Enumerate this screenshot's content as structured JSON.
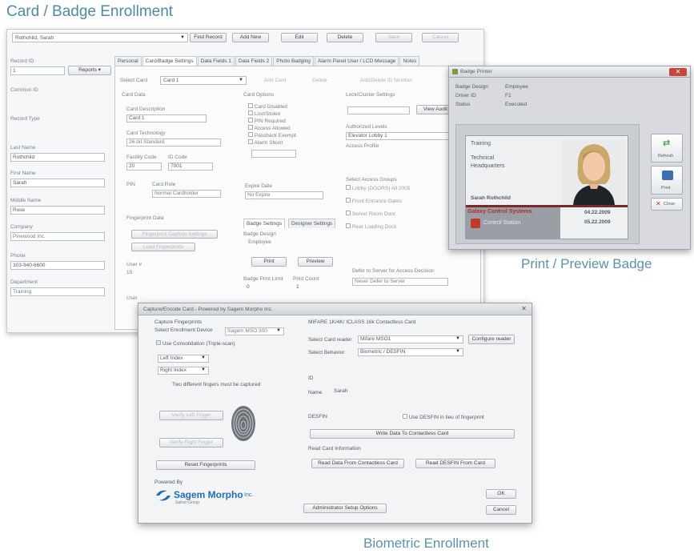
{
  "captions": {
    "title": "Card / Badge Enrollment",
    "print_preview": "Print / Preview Badge",
    "biometric": "Biometric Enrollment"
  },
  "main": {
    "name_select": "Rothchild, Sarah",
    "toolbar": [
      "Find Record",
      "Add New",
      "Edit",
      "Delete",
      "Save",
      "Cancel"
    ],
    "left_fields": [
      {
        "label": "Record ID",
        "value": "1"
      },
      {
        "label": "Common ID",
        "value": ""
      },
      {
        "label": "Record Type",
        "value": ""
      },
      {
        "label": "Last Name",
        "value": "Rothchild"
      },
      {
        "label": "First Name",
        "value": "Sarah"
      },
      {
        "label": "Middle Name",
        "value": "Rose"
      },
      {
        "label": "Company",
        "value": "Pinewood Inc."
      },
      {
        "label": "Phone",
        "value": "303-940-6600"
      },
      {
        "label": "Department",
        "value": "Training"
      }
    ],
    "reports_button": "Reports",
    "tabs": [
      "Personal",
      "Card/Badge Settings",
      "Data Fields 1",
      "Data Fields 2",
      "Photo Badging",
      "Alarm Panel User / LCD Message",
      "Notes"
    ],
    "select_card_label": "Select Card",
    "select_card_value": "Card 1",
    "card_buttons": [
      "Add Card",
      "Delete",
      "Add/Delete ID Number"
    ],
    "card_data": {
      "section": "Card Data",
      "description_label": "Card Description",
      "description_value": "Card 1",
      "technology_label": "Card Technology",
      "technology_value": "26-bit Standard",
      "facility_label": "Facility Code",
      "facility_value": "20",
      "id_code_label": "ID Code",
      "id_code_value": "7001",
      "pin_label": "PIN",
      "card_role_label": "Card Role",
      "card_role_value": "Normal Cardholder"
    },
    "card_options": {
      "section": "Card Options",
      "items": [
        "Card Disabled",
        "Lost/Stolen",
        "PIN Required",
        "Access Allowed",
        "Passback Exempt",
        "Alarm Shunt"
      ],
      "expire_label": "Expire Date",
      "expire_value": "No Expire"
    },
    "lock_cluster": {
      "section": "Lock/Cluster Settings",
      "audit_button": "View Audit",
      "auth_levels_label": "Authorized Levels",
      "auth_levels_value": "Elevator Lobby 1",
      "access_profile_label": "Access Profile",
      "access_groups_label": "Select Access Groups",
      "groups": [
        "Lobby (DOORS) All 2005",
        "Front Entrance Gates",
        "Server Room Door",
        "Rear Loading Dock"
      ]
    },
    "fingerprint_section": "Fingerprint Data",
    "fingerprint_buttons": [
      "Fingerprint Capture Settings",
      "Load Fingerprints"
    ],
    "badge_settings": {
      "tab1": "Badge Settings",
      "tab2": "Designer Settings",
      "design_label": "Badge Design",
      "design_value": "Employee",
      "print_button": "Print",
      "preview_button": "Preview",
      "print_limit_label": "Badge Print Limit",
      "print_count_label": "Print Count",
      "print_limit_value": "0",
      "print_count_value": "1"
    },
    "defer_label": "Defer to Server for Access Decision",
    "defer_value": "Never Defer to Server",
    "user_no_label": "User #",
    "user_label": "User",
    "user_no_value": "15"
  },
  "badge_window": {
    "title": "Badge Printer",
    "info": [
      {
        "label": "Badge Design",
        "value": "Employee"
      },
      {
        "label": "Driver ID",
        "value": "F1"
      },
      {
        "label": "Status",
        "value": "Executed"
      }
    ],
    "card_lines": [
      "Training",
      "Technical",
      "Headquarters"
    ],
    "card_name": "Sarah Rothchild",
    "card_company": "Galaxy Control Systems",
    "card_subtitle": "Control Station",
    "card_dates": [
      "04.22.2009",
      "05.22.2009"
    ],
    "side_buttons": [
      "Refresh",
      "Print",
      "Close"
    ]
  },
  "bio_window": {
    "title": "Capture/Encode Card - Powered by Sagem Morpho Inc.",
    "capture_section": "Capture Fingerprints",
    "select_device_label": "Select Enrollment Device",
    "device_value": "Sagem MSO 300",
    "use_consolidation": "Use Consolidation (Triple-scan)",
    "finger1": "Left Index",
    "finger2": "Right Index",
    "two_fingers_note": "Two different fingers must be captured",
    "verify_buttons": [
      "Verify Left Finger",
      "Verify Right Finger"
    ],
    "reset_button": "Reset Fingerprints",
    "powered_by": "Powered By",
    "sagem_logo": "Sagem Morpho",
    "sagem_suffix": "Inc.",
    "sagem_tag": "Safran Group",
    "encode_section": "MIFARE 1K/4K/ ICLASS 16k Contactless Card",
    "select_card_reader_label": "Select Card reader",
    "card_reader_value": "Mifare MSO1",
    "configure_button": "Configure reader",
    "select_behavior_label": "Select Behavior",
    "behavior_value": "Biometric / DESFIN",
    "id_label": "ID",
    "name_label": "Name",
    "name_value": "Sarah",
    "desfin_label": "DESFIN",
    "use_desfin": "Use DESFIN in lieu of fingerprint",
    "write_button": "Write Data To Contactless Card",
    "read_card_label": "Read Card Information",
    "read_button": "Read Data From Contactless Card",
    "read_desfin_button": "Read DESFIN From Card",
    "admin_button": "Administrator Setup Options",
    "ok_button": "OK",
    "cancel_button": "Cancel"
  }
}
